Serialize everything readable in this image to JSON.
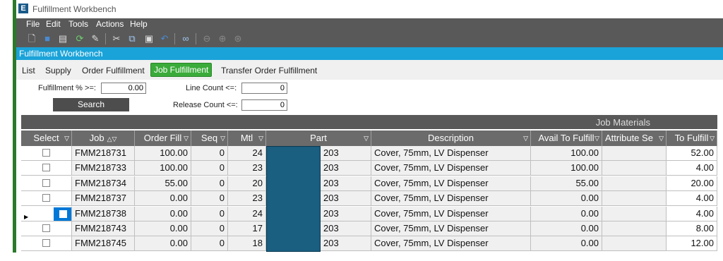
{
  "window": {
    "title": "Fulfillment Workbench",
    "app_icon": "E"
  },
  "menu": [
    "File",
    "Edit",
    "Tools",
    "Actions",
    "Help"
  ],
  "toolbar_icons": [
    "new-icon",
    "save-icon",
    "clipboard-icon",
    "refresh-icon",
    "eraser-icon",
    "cut-icon",
    "copy-icon",
    "paste-icon",
    "undo-icon",
    "binoculars-icon",
    "back-icon",
    "forward-icon",
    "home-icon"
  ],
  "panel": {
    "title": "Fulfillment Workbench"
  },
  "tabs": [
    {
      "label": "List",
      "active": false
    },
    {
      "label": "Supply",
      "active": false
    },
    {
      "label": "Order Fulfillment",
      "active": false
    },
    {
      "label": "Job Fulfillment",
      "active": true
    },
    {
      "label": "Transfer Order Fulfillment",
      "active": false
    }
  ],
  "filters": {
    "fulfillment_label": "Fulfillment % >=:",
    "fulfillment_value": "0.00",
    "line_count_label": "Line Count <=:",
    "line_count_value": "0",
    "release_count_label": "Release Count <=:",
    "release_count_value": "0",
    "search_label": "Search"
  },
  "grid": {
    "group_header": "Job Materials",
    "columns": [
      "Select",
      "Job",
      "Order Fill",
      "Seq",
      "Mtl",
      "Part",
      "Description",
      "Avail To Fulfill",
      "Attribute Se",
      "To Fulfill"
    ],
    "rows": [
      {
        "job": "FMM218731",
        "order_fill": "100.00",
        "seq": "0",
        "mtl": "24",
        "part": "203",
        "description": "Cover, 75mm, LV Dispenser",
        "avail": "100.00",
        "attr": "",
        "to_fulfill": "52.00"
      },
      {
        "job": "FMM218733",
        "order_fill": "100.00",
        "seq": "0",
        "mtl": "23",
        "part": "203",
        "description": "Cover, 75mm, LV Dispenser",
        "avail": "100.00",
        "attr": "",
        "to_fulfill": "4.00"
      },
      {
        "job": "FMM218734",
        "order_fill": "55.00",
        "seq": "0",
        "mtl": "20",
        "part": "203",
        "description": "Cover, 75mm, LV Dispenser",
        "avail": "55.00",
        "attr": "",
        "to_fulfill": "20.00"
      },
      {
        "job": "FMM218737",
        "order_fill": "0.00",
        "seq": "0",
        "mtl": "23",
        "part": "203",
        "description": "Cover, 75mm, LV Dispenser",
        "avail": "0.00",
        "attr": "",
        "to_fulfill": "4.00"
      },
      {
        "job": "FMM218738",
        "order_fill": "0.00",
        "seq": "0",
        "mtl": "24",
        "part": "203",
        "description": "Cover, 75mm, LV Dispenser",
        "avail": "0.00",
        "attr": "",
        "to_fulfill": "4.00"
      },
      {
        "job": "FMM218743",
        "order_fill": "0.00",
        "seq": "0",
        "mtl": "17",
        "part": "203",
        "description": "Cover, 75mm, LV Dispenser",
        "avail": "0.00",
        "attr": "",
        "to_fulfill": "8.00"
      },
      {
        "job": "FMM218745",
        "order_fill": "0.00",
        "seq": "0",
        "mtl": "18",
        "part": "203",
        "description": "Cover, 75mm, LV Dispenser",
        "avail": "0.00",
        "attr": "",
        "to_fulfill": "12.00"
      }
    ],
    "current_row_index": 4
  },
  "colors": {
    "menu_bg": "#595959",
    "panel_title_bg": "#1aa3d9",
    "active_tab": "#3aab3a",
    "redaction": "#1a5e80"
  }
}
